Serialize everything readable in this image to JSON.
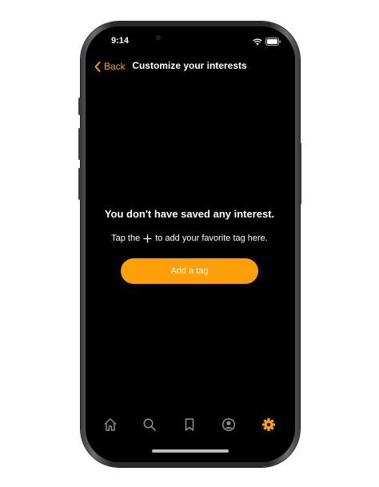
{
  "status_bar": {
    "time": "9:14"
  },
  "nav": {
    "back_label": "Back",
    "title": "Customize your interests"
  },
  "empty_state": {
    "title": "You don't have saved any interest.",
    "hint_prefix": "Tap the",
    "hint_suffix": "to add your favorite tag here.",
    "button_label": "Add a tag"
  },
  "tab_bar": {
    "items": [
      {
        "icon": "home-icon",
        "active": false
      },
      {
        "icon": "search-icon",
        "active": false
      },
      {
        "icon": "bookmark-icon",
        "active": false
      },
      {
        "icon": "profile-icon",
        "active": false
      },
      {
        "icon": "gear-icon",
        "active": true
      }
    ]
  },
  "colors": {
    "accent": "#ff9f0a",
    "background": "#000000",
    "text": "#ffffff",
    "tab_inactive": "#8e8e93"
  }
}
